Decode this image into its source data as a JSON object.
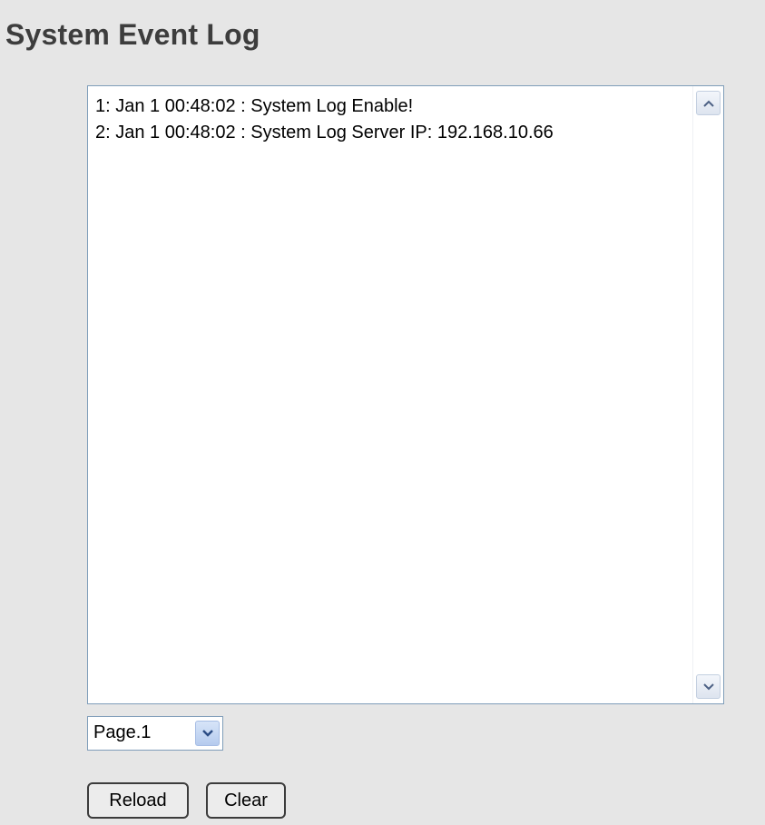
{
  "page": {
    "title": "System Event Log"
  },
  "log": {
    "lines": [
      "1: Jan 1 00:48:02 : System Log Enable!",
      "2: Jan 1 00:48:02 : System Log Server IP: 192.168.10.66"
    ]
  },
  "pager": {
    "selected": "Page.1"
  },
  "actions": {
    "reload_label": "Reload",
    "clear_label": "Clear"
  },
  "icons": {
    "scroll_up": "chevron-up-icon",
    "scroll_down": "chevron-down-icon",
    "select_arrow": "chevron-down-icon"
  },
  "colors": {
    "background": "#e6e6e6",
    "title": "#3d3d3d",
    "border": "#7f9db9"
  }
}
